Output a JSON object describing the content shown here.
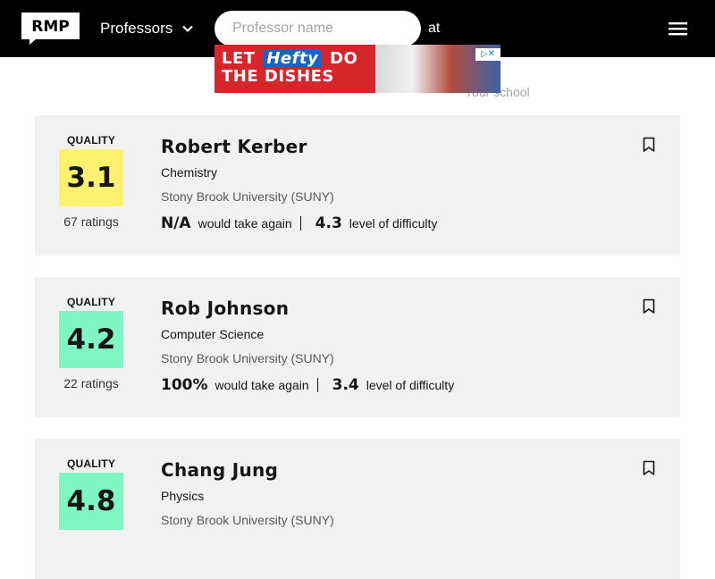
{
  "header": {
    "logo_text": "RMP",
    "nav_label": "Professors",
    "at_label": "at",
    "professor_search": {
      "placeholder": "Professor name",
      "value": ""
    },
    "school_search": {
      "placeholder": "Your school",
      "value": ""
    }
  },
  "ad": {
    "text_lead": "LET",
    "brand": "Hefty",
    "text_do": "DO",
    "text_tail": "THE DISHES",
    "badge": "▷✕"
  },
  "professors": [
    {
      "quality_label": "QUALITY",
      "quality": "3.1",
      "quality_color": "#fff170",
      "ratings": "67 ratings",
      "name": "Robert Kerber",
      "department": "Chemistry",
      "school": "Stony Brook University (SUNY)",
      "take_again": "N/A",
      "take_again_label": "would take again",
      "difficulty": "4.3",
      "difficulty_label": "level of difficulty"
    },
    {
      "quality_label": "QUALITY",
      "quality": "4.2",
      "quality_color": "#7ff6c3",
      "ratings": "22 ratings",
      "name": "Rob Johnson",
      "department": "Computer Science",
      "school": "Stony Brook University (SUNY)",
      "take_again": "100%",
      "take_again_label": "would take again",
      "difficulty": "3.4",
      "difficulty_label": "level of difficulty"
    },
    {
      "quality_label": "QUALITY",
      "quality": "4.8",
      "quality_color": "#7ff6c3",
      "ratings": "",
      "name": "Chang Jung",
      "department": "Physics",
      "school": "Stony Brook University (SUNY)",
      "take_again": "",
      "take_again_label": "",
      "difficulty": "",
      "difficulty_label": ""
    }
  ],
  "icons": {
    "logo": "rmp-logo-icon",
    "nav_chevron": "chevron-down-icon",
    "menu": "hamburger-menu-icon",
    "bookmark": "bookmark-icon"
  },
  "colors": {
    "header_bg": "#000000",
    "card_bg": "#f1f1f1",
    "quality_yellow": "#fff170",
    "quality_green": "#7ff6c3"
  }
}
